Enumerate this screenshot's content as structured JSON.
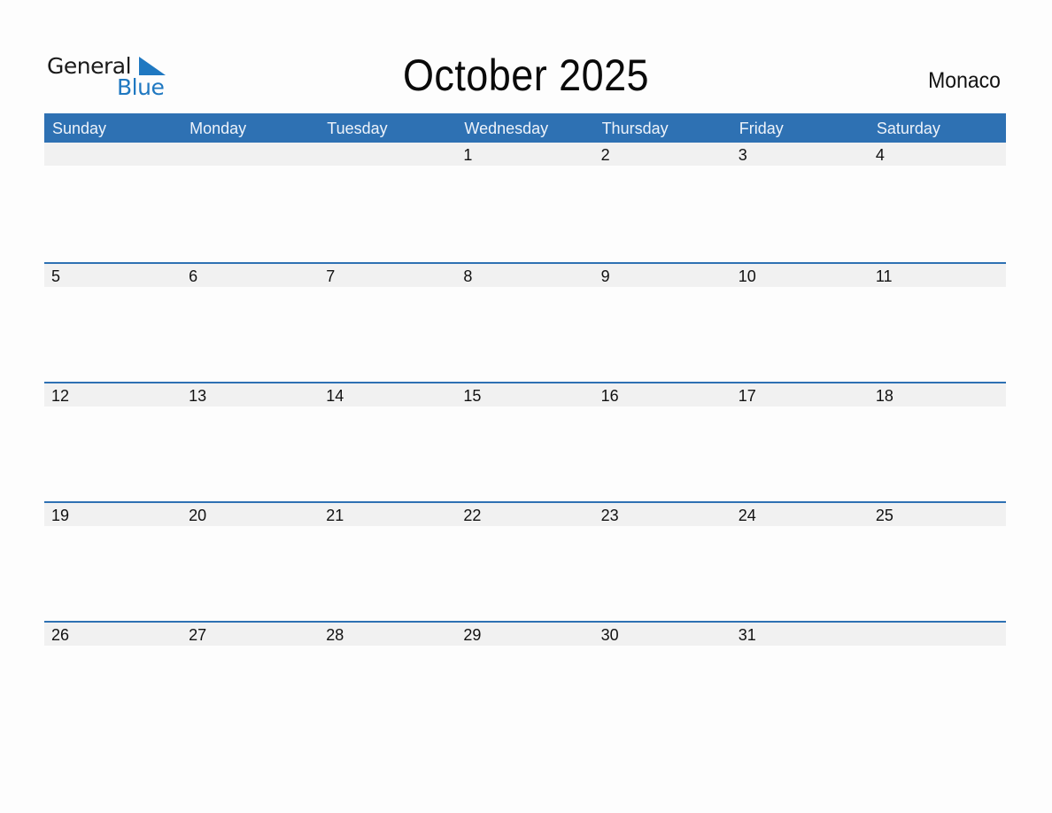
{
  "logo": {
    "line1": "General",
    "line2": "Blue"
  },
  "title": "October 2025",
  "country": "Monaco",
  "colors": {
    "header": "#2e71b3",
    "logo_blue": "#1f78c1",
    "day_strip": "#f1f1f1"
  },
  "weekdays": [
    "Sunday",
    "Monday",
    "Tuesday",
    "Wednesday",
    "Thursday",
    "Friday",
    "Saturday"
  ],
  "weeks": [
    [
      "",
      "",
      "",
      "1",
      "2",
      "3",
      "4"
    ],
    [
      "5",
      "6",
      "7",
      "8",
      "9",
      "10",
      "11"
    ],
    [
      "12",
      "13",
      "14",
      "15",
      "16",
      "17",
      "18"
    ],
    [
      "19",
      "20",
      "21",
      "22",
      "23",
      "24",
      "25"
    ],
    [
      "26",
      "27",
      "28",
      "29",
      "30",
      "31",
      ""
    ]
  ]
}
